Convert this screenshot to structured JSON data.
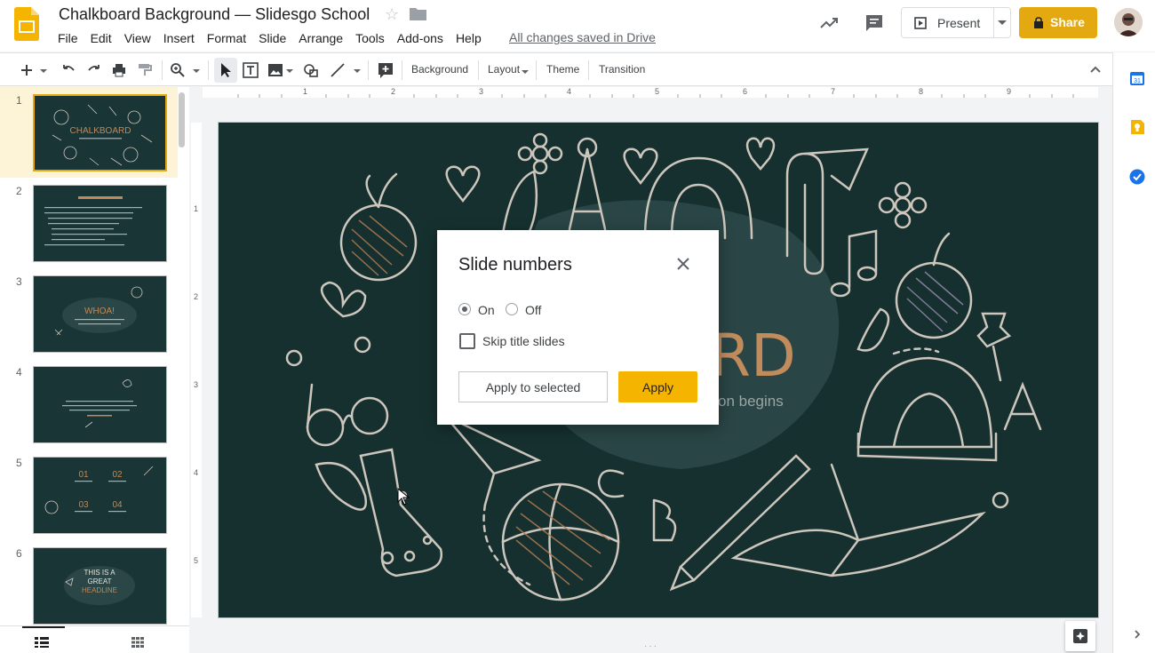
{
  "header": {
    "doc_title": "Chalkboard Background — Slidesgo School",
    "menu": [
      "File",
      "Edit",
      "View",
      "Insert",
      "Format",
      "Slide",
      "Arrange",
      "Tools",
      "Add-ons",
      "Help"
    ],
    "save_status": "All changes saved in Drive",
    "present_label": "Present",
    "share_label": "Share"
  },
  "toolbar": {
    "background_label": "Background",
    "layout_label": "Layout",
    "theme_label": "Theme",
    "transition_label": "Transition"
  },
  "ruler": {
    "h_marks": [
      "1",
      "2",
      "3",
      "4",
      "5",
      "6",
      "7",
      "8",
      "9"
    ],
    "v_marks": [
      "1",
      "2",
      "3",
      "4",
      "5"
    ]
  },
  "filmstrip": {
    "slides": [
      {
        "number": "1",
        "selected": true
      },
      {
        "number": "2",
        "selected": false
      },
      {
        "number": "3",
        "selected": false
      },
      {
        "number": "4",
        "selected": false
      },
      {
        "number": "5",
        "selected": false
      },
      {
        "number": "6",
        "selected": false
      }
    ]
  },
  "slide": {
    "title_partial": "ARD",
    "subtitle_partial": "on begins"
  },
  "dialog": {
    "title": "Slide numbers",
    "on_label": "On",
    "off_label": "Off",
    "skip_label": "Skip title slides",
    "apply_selected_label": "Apply to selected",
    "apply_label": "Apply",
    "on_selected": true,
    "skip_checked": false
  },
  "colors": {
    "accent": "#f4b400",
    "share": "#e4a911",
    "slide_bg": "#163030",
    "chalk_orange": "#c08a5a",
    "chalk_line": "#c9c4bd"
  }
}
